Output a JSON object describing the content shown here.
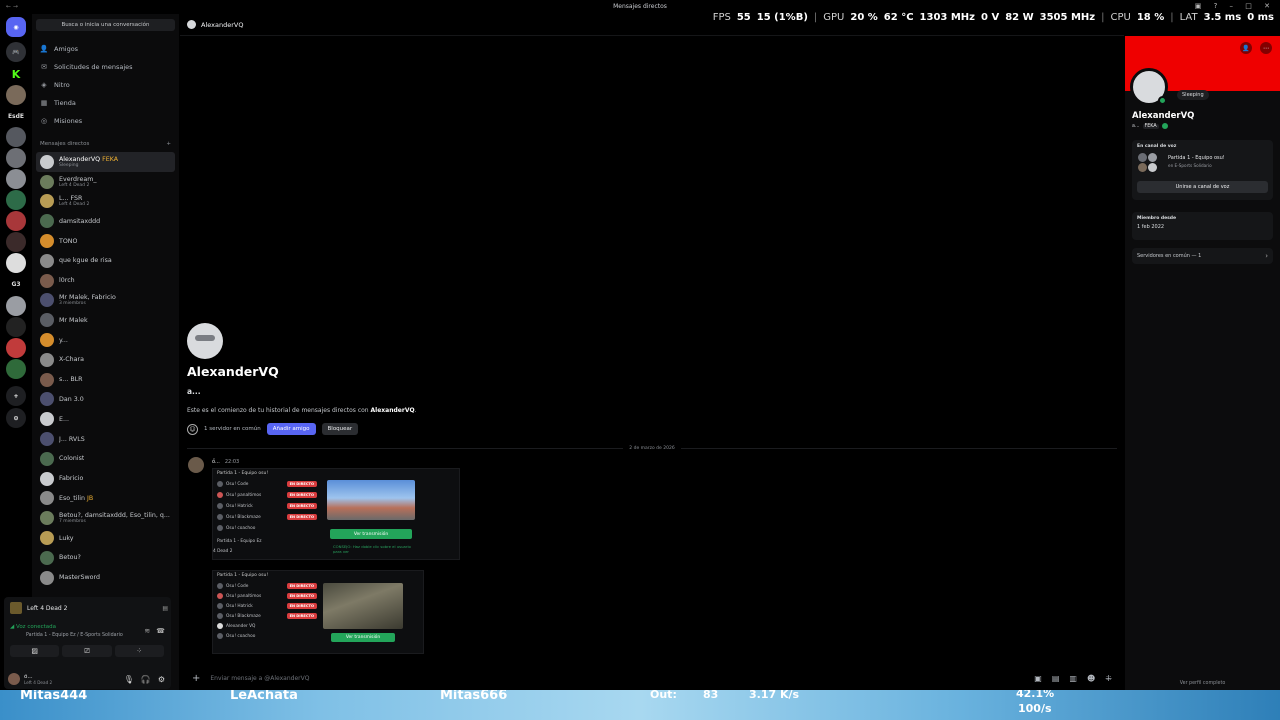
{
  "window": {
    "title": "Mensajes directos"
  },
  "overlay": {
    "fps_label": "FPS",
    "fps": "55",
    "fps_low": "15 (1%B)",
    "gpu_label": "GPU",
    "gpu_load": "20 %",
    "gpu_temp": "62 °C",
    "gpu_clock": "1303 MHz",
    "gpu_volt": "0 V",
    "gpu_power": "82 W",
    "gpu_mem_clock": "3505 MHz",
    "cpu_label": "CPU",
    "cpu_load": "18 %",
    "lat_label": "LAT",
    "lat_val": "3.5 ms",
    "lat_val2": "0 ms"
  },
  "servers": {
    "items": [
      {
        "label": "",
        "icon": "discord-icon"
      },
      {
        "label": "",
        "icon": "game-icon"
      },
      {
        "label": "K",
        "icon": "server-k"
      },
      {
        "label": "",
        "icon": "server-avatar"
      },
      {
        "label": "EsdE",
        "icon": "server-text"
      },
      {
        "label": "",
        "icon": "server-avatar"
      },
      {
        "label": "",
        "icon": "server-avatar"
      },
      {
        "label": "",
        "icon": "server-avatar"
      },
      {
        "label": "",
        "icon": "server-avatar"
      },
      {
        "label": "",
        "icon": "server-avatar"
      },
      {
        "label": "",
        "icon": "server-avatar"
      },
      {
        "label": "",
        "icon": "server-avatar"
      },
      {
        "label": "",
        "icon": "server-avatar"
      },
      {
        "label": "G3",
        "icon": "server-text"
      },
      {
        "label": "",
        "icon": "server-avatar"
      },
      {
        "label": "",
        "icon": "server-avatar"
      },
      {
        "label": "",
        "icon": "server-avatar"
      },
      {
        "label": "",
        "icon": "server-avatar"
      },
      {
        "label": "",
        "icon": "server-avatar"
      }
    ]
  },
  "sidebar": {
    "search_placeholder": "Busca o inicia una conversación",
    "nav": [
      {
        "label": "Amigos",
        "icon": "friends-icon"
      },
      {
        "label": "Solicitudes de mensajes",
        "icon": "message-requests-icon"
      },
      {
        "label": "Nitro",
        "icon": "nitro-icon"
      },
      {
        "label": "Tienda",
        "icon": "shop-icon"
      },
      {
        "label": "Misiones",
        "icon": "quests-icon"
      }
    ],
    "dm_header": "Mensajes directos",
    "dms": [
      {
        "name": "AlexanderVQ",
        "tag": "FEKA",
        "sub": "Sleeping",
        "active": true
      },
      {
        "name": "Everdream_",
        "sub": "Left 4 Dead 2"
      },
      {
        "name": "L...",
        "tag": "FSR",
        "sub": "Left 4 Dead 2"
      },
      {
        "name": "damsitaxddd",
        "sub": ""
      },
      {
        "name": "TOÑO",
        "sub": ""
      },
      {
        "name": "que kgue de risa",
        "sub": ""
      },
      {
        "name": "l0rch",
        "sub": ""
      },
      {
        "name": "Mr Malek, Fabricio",
        "sub": "3 miembros"
      },
      {
        "name": "Mr Malek",
        "sub": ""
      },
      {
        "name": "y...",
        "sub": ""
      },
      {
        "name": "X-Chara",
        "sub": ""
      },
      {
        "name": "s...",
        "tag": "BLR",
        "sub": ""
      },
      {
        "name": "Dan 3.0",
        "sub": ""
      },
      {
        "name": "E...",
        "sub": ""
      },
      {
        "name": "J...",
        "tag": "RVLS",
        "sub": ""
      },
      {
        "name": "Colonist",
        "sub": ""
      },
      {
        "name": "Fabricio",
        "sub": ""
      },
      {
        "name": "Eso_tilin",
        "tag": "JB",
        "sub": ""
      },
      {
        "name": "Betou?, damsitaxddd, Eso_tilin, q...",
        "sub": "7 miembros"
      },
      {
        "name": "Luky",
        "sub": ""
      },
      {
        "name": "Betou?",
        "sub": ""
      },
      {
        "name": "MasterSword",
        "sub": ""
      }
    ],
    "voice": {
      "game": "Left 4 Dead 2",
      "status": "Voz conectada",
      "channel": "Partida 1 - Equipo Ez / E-Sports Solidario"
    },
    "user": {
      "name": "ő...",
      "sub": "Left 4 Dead 2"
    }
  },
  "chat": {
    "header_name": "AlexanderVQ",
    "welcome_name": "AlexanderVQ",
    "welcome_handle": "a...",
    "welcome_text_prefix": "Este es el comienzo de tu historial de mensajes directos con",
    "welcome_text_name": "AlexanderVQ",
    "mutual": "1 servidor en común",
    "add_friend": "Añadir amigo",
    "block": "Bloquear",
    "date_divider": "2 de marzo de 2026",
    "message": {
      "author": "ő...",
      "time": "22:03",
      "shot1": {
        "title": "Partida 1 - Equipo osu!",
        "rows": [
          "Osu! Code",
          "Osu! panaltimos",
          "Osu! Hatrick",
          "Osu! Blackmaze",
          "Osu! coachoo"
        ],
        "live": "EN DIRECTO",
        "footer1": "Partida 1 - Equipo Ez",
        "footer2": "4 Dead 2",
        "watch": "Ver transmisión",
        "note": "CONSEJO: Haz doble clic sobre el usuario para ver"
      },
      "shot2": {
        "title": "Partida 1 - Equipo osu!",
        "rows": [
          "Osu! Code",
          "Osu! panaltimos",
          "Osu! Hatrick",
          "Osu! Blackmaze",
          "Alexander VQ",
          "Osu! coachoo"
        ],
        "live": "EN DIRECTO",
        "watch": "Ver transmisión"
      }
    },
    "composer_placeholder": "Enviar mensaje a @AlexanderVQ"
  },
  "profile": {
    "banner_color": "#ef0000",
    "bubble": "Sleeping",
    "name": "AlexanderVQ",
    "handle": "a...",
    "tag": "FEKA",
    "voice_header": "En canal de voz",
    "voice_channel": "Partida 1 - Equipo osu!",
    "voice_server": "en E-Sports Solidario",
    "join_voice": "Unirse a canal de voz",
    "member_since_label": "Miembro desde",
    "member_since": "1 feb 2022",
    "mutual_servers": "Servidores en común — 1",
    "full_profile": "Ver perfil completo"
  },
  "taskbar": {
    "items": [
      "Mitas444",
      "LeAchata",
      "Mitas666",
      "Out:",
      "83",
      "3.17 K/s",
      "42.1%",
      "100/s"
    ]
  }
}
